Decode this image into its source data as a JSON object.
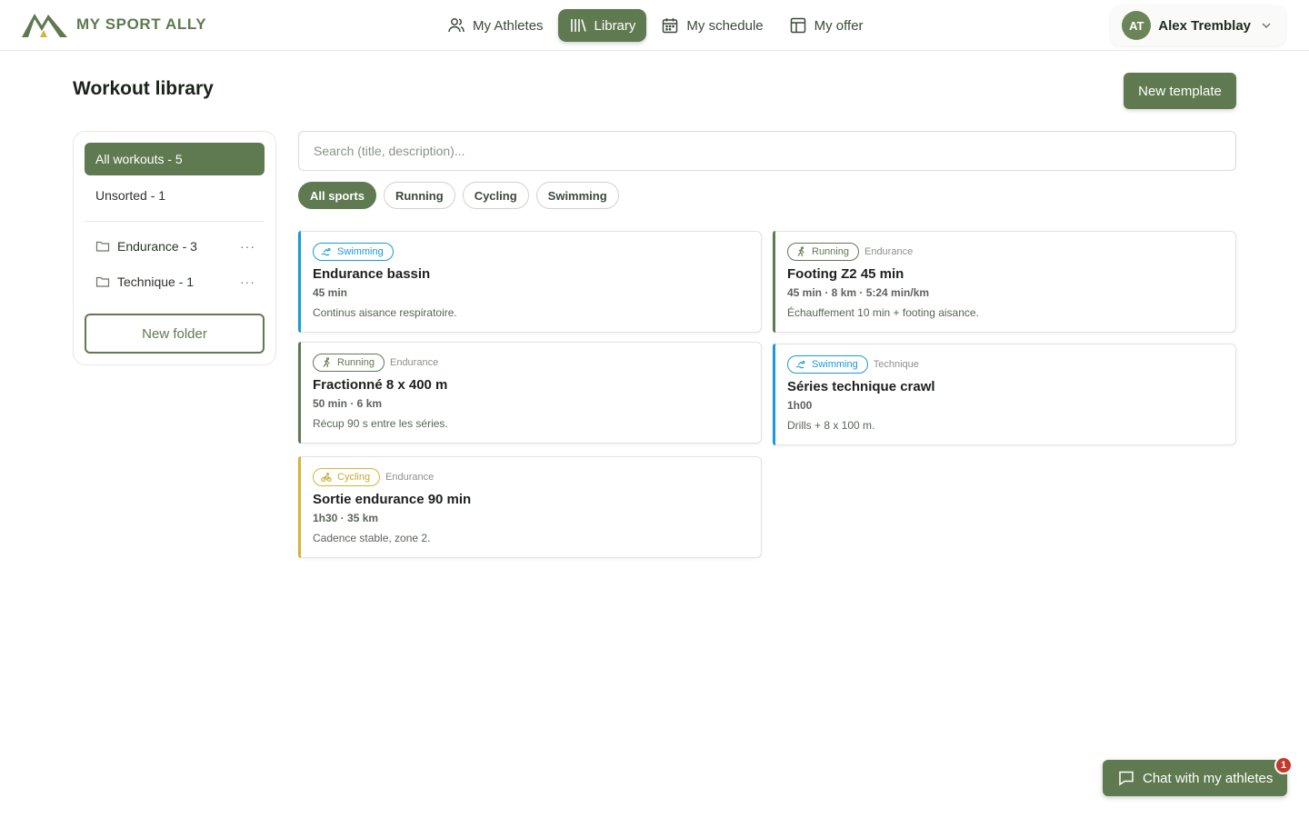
{
  "brand": {
    "name": "MY SPORT ALLY"
  },
  "nav": [
    {
      "label": "My Athletes",
      "icon": "users-icon",
      "active": false
    },
    {
      "label": "Library",
      "icon": "library-icon",
      "active": true
    },
    {
      "label": "My schedule",
      "icon": "calendar-icon",
      "active": false
    },
    {
      "label": "My offer",
      "icon": "layout-icon",
      "active": false
    }
  ],
  "user": {
    "initials": "AT",
    "name": "Alex Tremblay"
  },
  "page": {
    "title": "Workout library",
    "new_template_label": "New template"
  },
  "sidebar": {
    "all_label": "All workouts - 5",
    "unsorted_label": "Unsorted - 1",
    "folders": [
      {
        "label": "Endurance - 3",
        "more": "···"
      },
      {
        "label": "Technique - 1",
        "more": "···"
      }
    ],
    "new_folder_label": "New folder"
  },
  "search": {
    "placeholder": "Search (title, description)...",
    "value": ""
  },
  "filters": [
    {
      "label": "All sports",
      "active": true
    },
    {
      "label": "Running",
      "active": false
    },
    {
      "label": "Cycling",
      "active": false
    },
    {
      "label": "Swimming",
      "active": false
    }
  ],
  "colors": {
    "accent": "#5f7a50",
    "swimming": "#1a9ad6",
    "running": "#5f7a50",
    "cycling": "#d4b43a",
    "badge": "#c0392b"
  },
  "workouts": [
    {
      "sport": "Swimming",
      "folder": "",
      "title": "Endurance bassin",
      "meta": "45 min",
      "description": "Continus aisance respiratoire."
    },
    {
      "sport": "Running",
      "folder": "Endurance",
      "title": "Footing Z2 45 min",
      "meta": "45 min · 8 km · 5:24 min/km",
      "description": "Échauffement 10 min + footing aisance."
    },
    {
      "sport": "Running",
      "folder": "Endurance",
      "title": "Fractionné 8 x 400 m",
      "meta": "50 min · 6 km",
      "description": "Récup 90 s entre les séries."
    },
    {
      "sport": "Swimming",
      "folder": "Technique",
      "title": "Séries technique crawl",
      "meta": "1h00",
      "description": "Drills + 8 x 100 m."
    },
    {
      "sport": "Cycling",
      "folder": "Endurance",
      "title": "Sortie endurance 90 min",
      "meta": "1h30 · 35 km",
      "description": "Cadence stable, zone 2."
    }
  ],
  "chat": {
    "label": "Chat with my athletes",
    "badge": "1"
  }
}
